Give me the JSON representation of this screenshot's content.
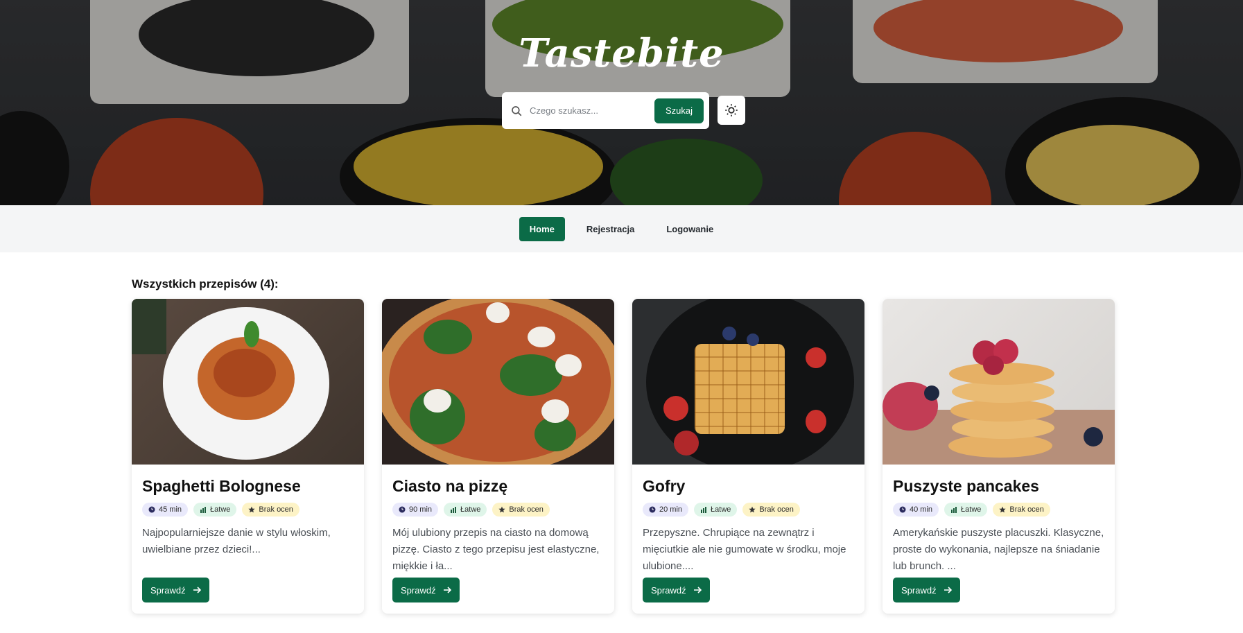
{
  "header": {
    "brand": "Tastebite",
    "search_placeholder": "Czego szukasz...",
    "search_button": "Szukaj",
    "theme_toggle_icon": "sun-icon"
  },
  "nav": {
    "items": [
      {
        "label": "Home",
        "active": true
      },
      {
        "label": "Rejestracja",
        "active": false
      },
      {
        "label": "Logowanie",
        "active": false
      }
    ]
  },
  "main": {
    "title": "Wszystkich przepisów (4):",
    "recipes": [
      {
        "title": "Spaghetti Bolognese",
        "time": "45 min",
        "difficulty": "Łatwe",
        "rating": "Brak ocen",
        "description": "Najpopularniejsze danie w stylu włoskim, uwielbiane przez dzieci!...",
        "button": "Sprawdź"
      },
      {
        "title": "Ciasto na pizzę",
        "time": "90 min",
        "difficulty": "Łatwe",
        "rating": "Brak ocen",
        "description": "Mój ulubiony przepis na ciasto na domową pizzę. Ciasto z tego przepisu jest elastyczne, miękkie i ła...",
        "button": "Sprawdź"
      },
      {
        "title": "Gofry",
        "time": "20 min",
        "difficulty": "Łatwe",
        "rating": "Brak ocen",
        "description": "Przepyszne. Chrupiące na zewnątrz i mięciutkie ale nie gumowate w środku, moje ulubione....",
        "button": "Sprawdź"
      },
      {
        "title": "Puszyste pancakes",
        "time": "40 min",
        "difficulty": "Łatwe",
        "rating": "Brak ocen",
        "description": "Amerykańskie puszyste placuszki. Klasyczne, proste do wykonania, najlepsze na śniadanie lub brunch. ...",
        "button": "Sprawdź"
      }
    ]
  },
  "colors": {
    "primary": "#0b6b47",
    "nav_bg": "#f4f5f6",
    "badge_time": "#e9e9fb",
    "badge_difficulty": "#dff5e9",
    "badge_rating": "#fdf3c6"
  }
}
